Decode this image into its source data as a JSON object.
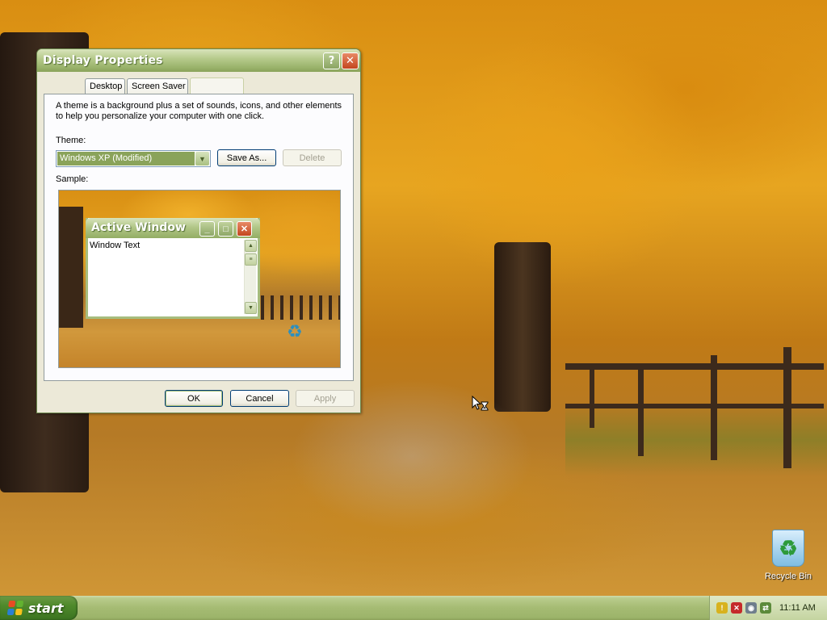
{
  "dialog": {
    "title": "Display Properties",
    "help_glyph": "?",
    "close_glyph": "✕",
    "tabs": [
      {
        "label": "Desktop"
      },
      {
        "label": "Screen Saver"
      },
      {
        "label": ""
      }
    ],
    "description": "A theme is a background plus a set of sounds, icons, and other elements to help you personalize your computer with one click.",
    "theme_label": "Theme:",
    "theme_value": "Windows XP (Modified)",
    "save_as_label": "Save As...",
    "delete_label": "Delete",
    "sample_label": "Sample:",
    "sample_window": {
      "title": "Active Window",
      "text": "Window Text"
    },
    "ok_label": "OK",
    "cancel_label": "Cancel",
    "apply_label": "Apply"
  },
  "desktop": {
    "recycle_bin_label": "Recycle Bin"
  },
  "taskbar": {
    "start_label": "start",
    "clock": "11:11 AM",
    "tray_icons": [
      "security-shield-icon",
      "antivirus-icon",
      "network-icon",
      "connection-icon"
    ]
  },
  "colors": {
    "theme_accent": "#8aa35a",
    "close_red": "#c3461f",
    "start_green": "#4f8a2b"
  }
}
